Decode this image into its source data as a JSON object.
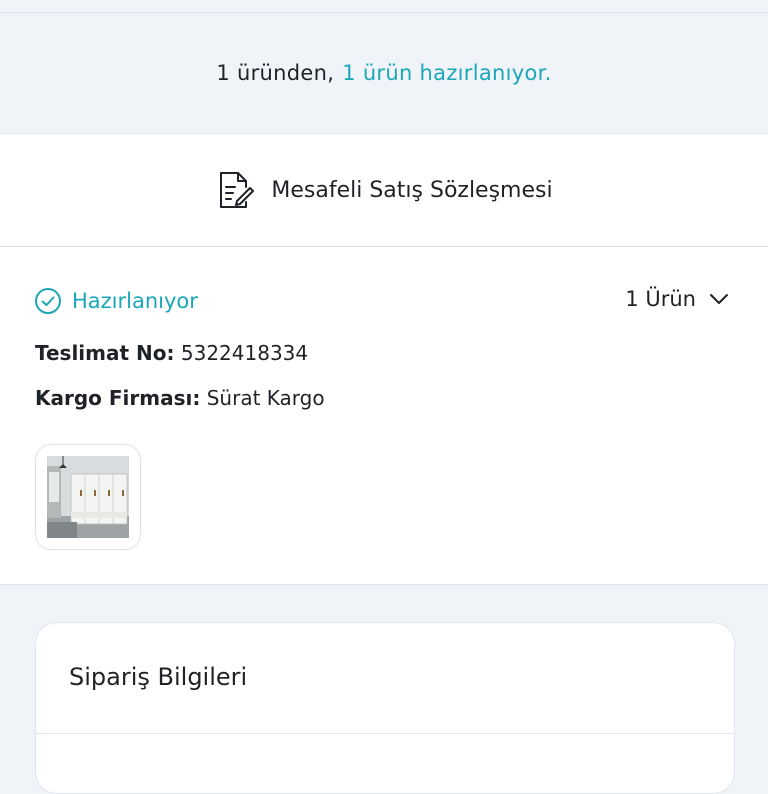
{
  "summary": {
    "prefix": "1 üründen,",
    "highlight": "1 ürün hazırlanıyor."
  },
  "contract": {
    "icon": "document-edit-icon",
    "label": "Mesafeli Satış Sözleşmesi"
  },
  "shipment": {
    "status_icon": "check-circle-icon",
    "status": "Hazırlanıyor",
    "item_count": "1 Ürün",
    "delivery_no_label": "Teslimat No:",
    "delivery_no": "5322418334",
    "carrier_label": "Kargo Firması:",
    "carrier": "Sürat Kargo",
    "product_image": "wardrobe-product-thumbnail"
  },
  "order_info": {
    "title": "Sipariş Bilgileri"
  },
  "colors": {
    "accent": "#1aa7b8",
    "background": "#f0f3f8",
    "card": "#ffffff"
  }
}
